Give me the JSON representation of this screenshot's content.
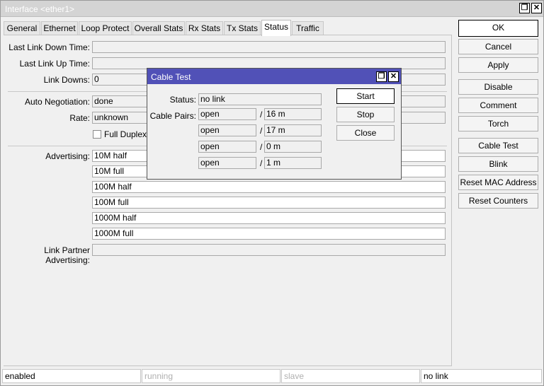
{
  "window": {
    "title": "Interface <ether1>",
    "restore_glyph": "❐",
    "close_glyph": "✕"
  },
  "tabs": [
    "General",
    "Ethernet",
    "Loop Protect",
    "Overall Stats",
    "Rx Stats",
    "Tx Stats",
    "Status",
    "Traffic"
  ],
  "active_tab": "Status",
  "fields": {
    "last_link_down_label": "Last Link Down Time:",
    "last_link_down_value": "",
    "last_link_up_label": "Last Link Up Time:",
    "last_link_up_value": "",
    "link_downs_label": "Link Downs:",
    "link_downs_value": "0",
    "auto_neg_label": "Auto Negotiation:",
    "auto_neg_value": "done",
    "rate_label": "Rate:",
    "rate_value": "unknown",
    "full_duplex_label": "Full Duplex",
    "advertising_label": "Advertising:",
    "advertising": [
      "10M half",
      "10M full",
      "100M half",
      "100M full",
      "1000M half",
      "1000M full"
    ],
    "link_partner_label": "Link Partner Advertising:",
    "link_partner_value": ""
  },
  "buttons": {
    "ok": "OK",
    "cancel": "Cancel",
    "apply": "Apply",
    "disable": "Disable",
    "comment": "Comment",
    "torch": "Torch",
    "cable_test": "Cable Test",
    "blink": "Blink",
    "reset_mac": "Reset MAC Address",
    "reset_counters": "Reset Counters"
  },
  "statusbar": [
    "enabled",
    "running",
    "slave",
    "no link"
  ],
  "cable_test": {
    "title": "Cable Test",
    "status_label": "Status:",
    "status_value": "no link",
    "pairs_label": "Cable Pairs:",
    "pairs": [
      {
        "state": "open",
        "length": "16 m"
      },
      {
        "state": "open",
        "length": "17 m"
      },
      {
        "state": "open",
        "length": "0 m"
      },
      {
        "state": "open",
        "length": "1 m"
      }
    ],
    "separator": "/",
    "start": "Start",
    "stop": "Stop",
    "close": "Close"
  },
  "colors": {
    "dialog_title_bg": "#5151b7",
    "window_title_bg": "#d4d4d4"
  }
}
